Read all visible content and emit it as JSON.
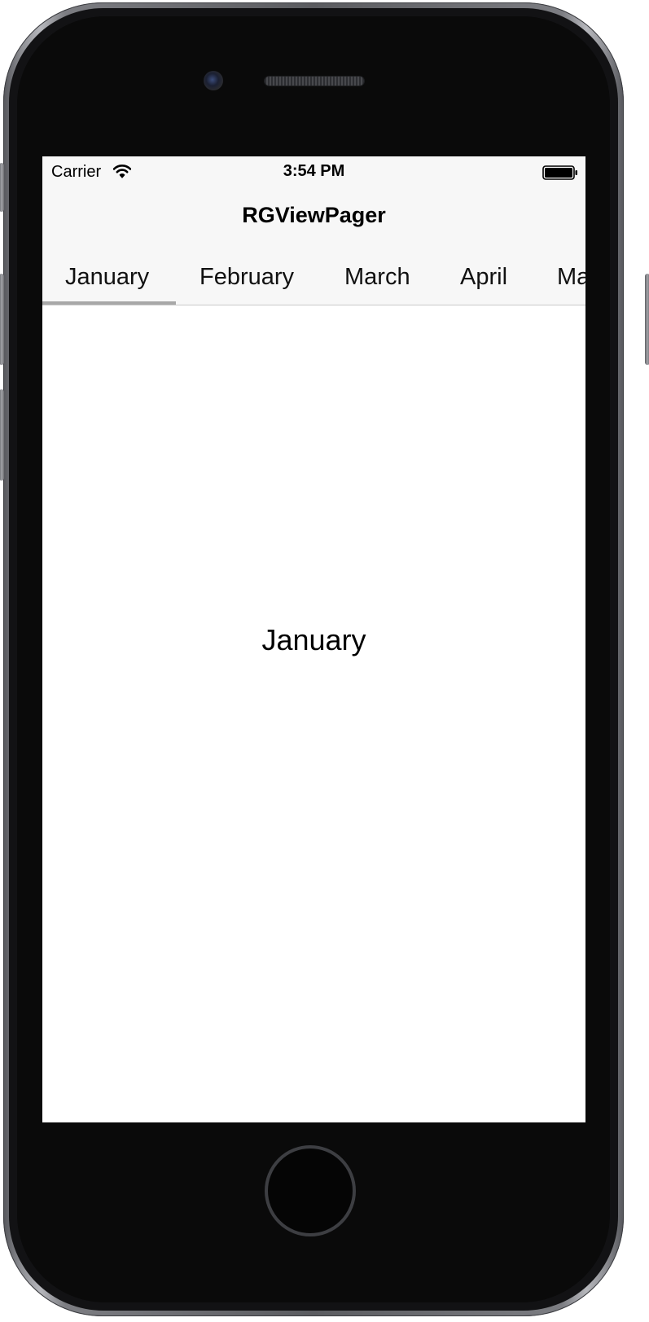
{
  "status_bar": {
    "carrier": "Carrier",
    "time": "3:54 PM",
    "wifi_icon": "wifi-icon",
    "battery_icon": "battery-icon"
  },
  "nav_bar": {
    "title": "RGViewPager"
  },
  "tabs": {
    "items": [
      {
        "label": "January"
      },
      {
        "label": "February"
      },
      {
        "label": "March"
      },
      {
        "label": "April"
      },
      {
        "label": "Ma"
      }
    ],
    "selected": "January",
    "indicator_color": "#a8a8a8"
  },
  "page": {
    "label": "January"
  },
  "colors": {
    "bar_background": "#f7f7f7",
    "content_background": "#ffffff",
    "device_body": "#0a0a0a"
  }
}
